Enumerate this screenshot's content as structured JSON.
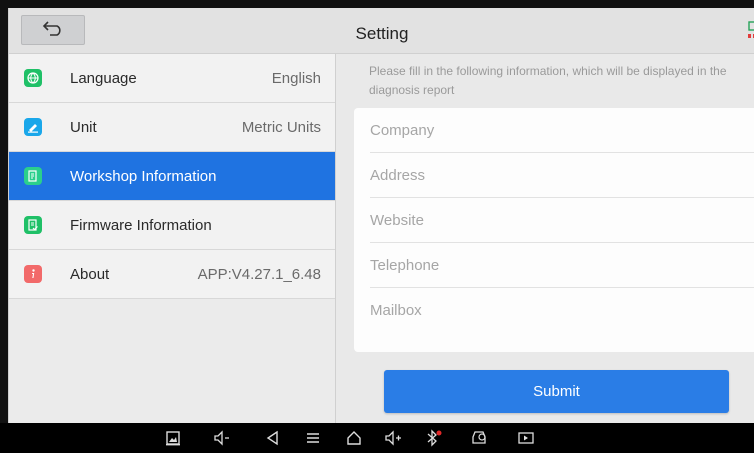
{
  "header": {
    "title": "Setting",
    "back_icon": "back-arrow-icon"
  },
  "sidebar": {
    "items": [
      {
        "label": "Language",
        "value": "English",
        "icon": "globe-icon",
        "color": "#1fc067",
        "active": false
      },
      {
        "label": "Unit",
        "value": "Metric Units",
        "icon": "pencil-icon",
        "color": "#1aa7ea",
        "active": false
      },
      {
        "label": "Workshop Information",
        "value": "",
        "icon": "document-icon",
        "color": "#2bcf8c",
        "active": true
      },
      {
        "label": "Firmware Information",
        "value": "",
        "icon": "document-check-icon",
        "color": "#1fc067",
        "active": false
      },
      {
        "label": "About",
        "value": "APP:V4.27.1_6.48",
        "icon": "info-icon",
        "color": "#f26a6a",
        "active": false
      }
    ]
  },
  "form": {
    "notice": "Please fill in the following information, which will be displayed in the diagnosis report",
    "fields": [
      {
        "placeholder": "Company"
      },
      {
        "placeholder": "Address"
      },
      {
        "placeholder": "Website"
      },
      {
        "placeholder": "Telephone"
      },
      {
        "placeholder": "Mailbox"
      }
    ],
    "submit_label": "Submit"
  },
  "navbar": {
    "icons": [
      "screenshot-icon",
      "volume-down-icon",
      "back-icon",
      "menu-icon",
      "home-icon",
      "volume-up-icon",
      "bluetooth-icon",
      "vci-icon",
      "screen-record-icon"
    ]
  },
  "colors": {
    "accent": "#1f73e1",
    "button": "#2a7de6"
  }
}
